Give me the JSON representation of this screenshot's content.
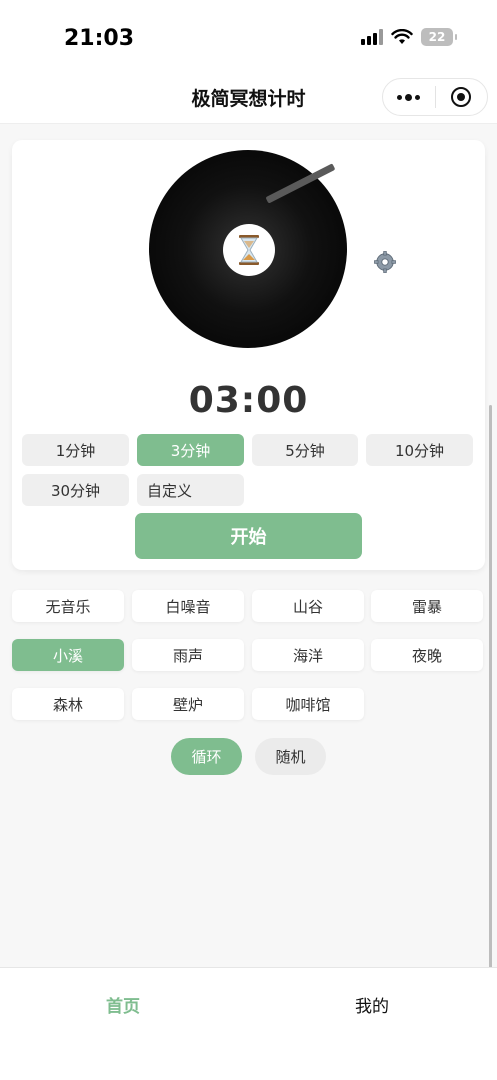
{
  "status_bar": {
    "time": "21:03",
    "battery": "22"
  },
  "nav": {
    "title": "极简冥想计时"
  },
  "timer": {
    "display": "03:00",
    "start_label": "开始"
  },
  "durations": [
    {
      "label": "1分钟",
      "active": false
    },
    {
      "label": "3分钟",
      "active": true
    },
    {
      "label": "5分钟",
      "active": false
    },
    {
      "label": "10分钟",
      "active": false
    },
    {
      "label": "30分钟",
      "active": false
    },
    {
      "label": "自定义",
      "active": false
    }
  ],
  "sounds": [
    {
      "label": "无音乐",
      "active": false
    },
    {
      "label": "白噪音",
      "active": false
    },
    {
      "label": "山谷",
      "active": false
    },
    {
      "label": "雷暴",
      "active": false
    },
    {
      "label": "小溪",
      "active": true
    },
    {
      "label": "雨声",
      "active": false
    },
    {
      "label": "海洋",
      "active": false
    },
    {
      "label": "夜晚",
      "active": false
    },
    {
      "label": "森林",
      "active": false
    },
    {
      "label": "壁炉",
      "active": false
    },
    {
      "label": "咖啡馆",
      "active": false
    }
  ],
  "modes": [
    {
      "label": "循环",
      "active": true
    },
    {
      "label": "随机",
      "active": false
    }
  ],
  "tabs": [
    {
      "label": "首页",
      "active": true
    },
    {
      "label": "我的",
      "active": false
    }
  ],
  "colors": {
    "accent": "#7fbd8f"
  }
}
